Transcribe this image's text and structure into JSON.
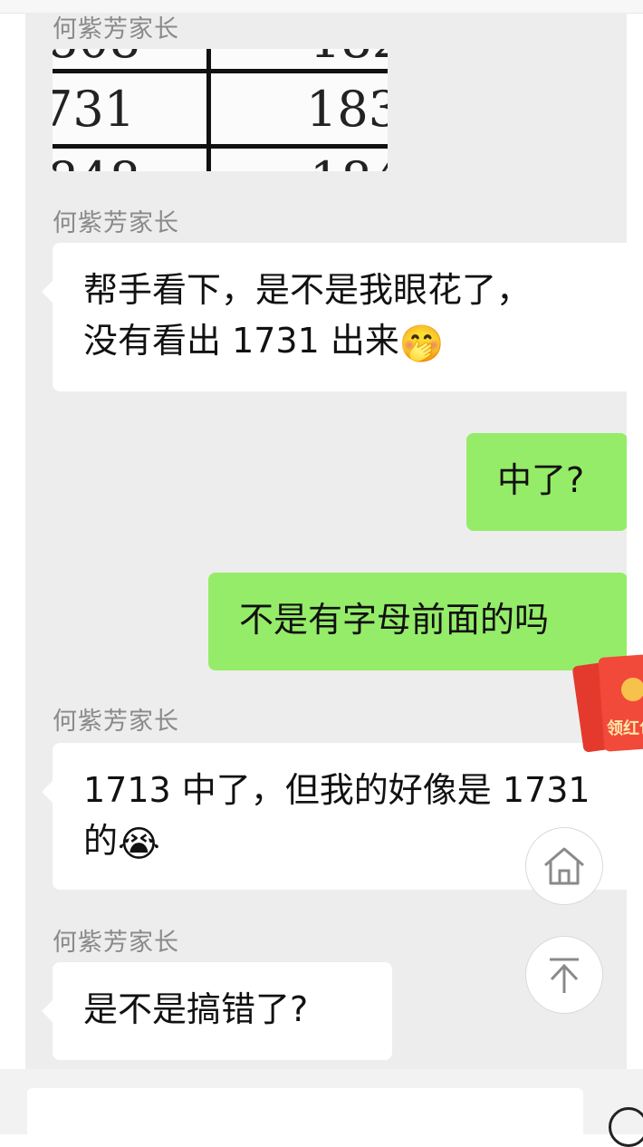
{
  "messages": [
    {
      "sender": "何紫芳家长"
    },
    {
      "sender": "何紫芳家长",
      "text": "帮手看下，是不是我眼花了，",
      "text2": "没有看出 1731 出来",
      "emoji": "🤭"
    },
    {
      "text": "中了?"
    },
    {
      "text": "不是有字母前面的吗"
    },
    {
      "sender": "何紫芳家长",
      "text": "1713 中了，但我的好像是 1731",
      "text2": "的",
      "emoji": "😭"
    },
    {
      "sender": "何紫芳家长",
      "text": "是不是搞错了?"
    }
  ],
  "image_message": {
    "cells": [
      "731",
      "183"
    ]
  },
  "red_packet": {
    "label": "领红包"
  },
  "float_buttons": {
    "home_icon": "home-icon",
    "top_icon": "back-to-top-icon"
  },
  "colors": {
    "chat_bg": "#ededed",
    "outgoing_bubble": "#95ec69",
    "incoming_bubble": "#ffffff"
  }
}
